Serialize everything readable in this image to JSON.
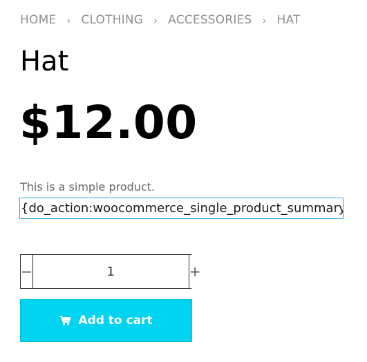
{
  "breadcrumb": {
    "items": [
      "HOME",
      "CLOTHING",
      "ACCESSORIES",
      "HAT"
    ],
    "separator": "›"
  },
  "product": {
    "title": "Hat",
    "price": "$12.00",
    "short_description": "This is a simple product.",
    "hook_text": "{do_action:woocommerce_single_product_summary}"
  },
  "quantity": {
    "minus_label": "−",
    "value": "1",
    "plus_label": "+"
  },
  "add_to_cart": {
    "label": "Add to cart",
    "icon": "cart-icon"
  },
  "colors": {
    "accent": "#00d4f0",
    "hook_border": "#2ea6de",
    "muted_text": "#8f8f8f"
  }
}
